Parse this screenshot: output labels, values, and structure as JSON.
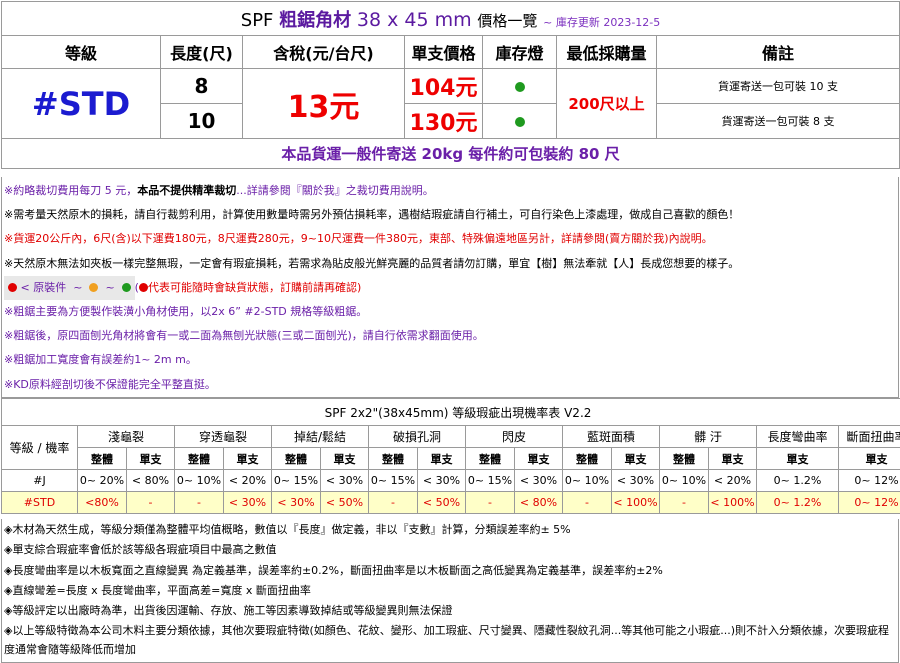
{
  "header": {
    "brand": "SPF",
    "material": "粗鋸角材",
    "size": "38 x 45 mm",
    "list": "價格一覽",
    "update": "~ 庫存更新 2023-12-5"
  },
  "columns": {
    "grade": "等級",
    "length": "長度(尺)",
    "tax": "含稅(元/台尺)",
    "unit_price": "單支價格",
    "stock": "庫存燈",
    "min_buy": "最低採購量",
    "remarks": "備註"
  },
  "product": {
    "grade": "#STD",
    "price": "13元",
    "min_buy": "200尺以上",
    "rows": [
      {
        "length": "8",
        "unit_price": "104元",
        "stock": "green-dot-icon",
        "remark": "貨運寄送一包可裝 10 支"
      },
      {
        "length": "10",
        "unit_price": "130元",
        "stock": "green-dot-icon",
        "remark": "貨運寄送一包可裝 8 支"
      }
    ]
  },
  "banner": "本品貨運一般件寄送 20kg 每件約可包裝約 80 尺",
  "notes": {
    "n1a": "※約略裁切費用每刀 5 元，",
    "n1b": "本品不提供精準裁切",
    "n1c": "...詳請參閱『關於我』之裁切費用說明。",
    "n2": "※需考量天然原木的損耗，請自行裁剪利用，計算使用數量時需另外預估損耗率，遇樹結瑕疵請自行補土，可自行染色上漆處理，做成自己喜歡的顏色！",
    "n3": "※貨運20公斤內，6尺(含)以下運費180元，8尺運費280元，9~10尺運費一件380元，東部、特殊偏遠地區另計，詳請參閱(賣方關於我)內說明。",
    "n4": "※天然原木無法如夾板一樣完整無瑕，一定會有瑕疵損耗，若需求為貼皮般光鮮亮麗的品質者請勿訂購，單宜【樹】無法牽就【人】長成您想要的樣子。",
    "n5_label": "< 原裝件",
    "n5_tilde": "~",
    "n5_paren": "(",
    "n5_text": "代表可能隨時會缺貨狀態，訂購前請再確認)",
    "n6": "※粗鋸主要為方便製作裝潢小角材使用，以2x 6”  #2-STD 規格等級粗鋸。",
    "n7": "※粗鋸後，原四面刨光角材將會有一或二面為無刨光狀態(三或二面刨光)，請自行依需求翻面使用。",
    "n8": "※粗鋸加工寬度會有誤差約1~ 2m m。",
    "n9": "※KD原料經剖切後不保證能完全平整直挺。"
  },
  "legend_colors": {
    "red": "#e00000",
    "orange": "#f0a020",
    "green": "#1f9a1f"
  },
  "defects": {
    "caption": "SPF 2x2\"(38x45mm) 等級瑕疵出現機率表 V2.2",
    "grade_header": "等級 / 機率",
    "categories": [
      "淺龜裂",
      "穿透龜裂",
      "掉結/鬆結",
      "破損孔洞",
      "閃皮",
      "藍斑面積",
      "髒 汙",
      "長度彎曲率",
      "斷面扭曲率"
    ],
    "sub_whole": "整體",
    "sub_single": "單支",
    "rows": [
      {
        "grade": "#J",
        "cells": [
          "0~ 20%",
          "< 80%",
          "0~ 10%",
          "< 20%",
          "0~ 15%",
          "< 30%",
          "0~ 15%",
          "< 30%",
          "0~ 15%",
          "< 30%",
          "0~ 10%",
          "< 30%",
          "0~ 10%",
          "< 20%",
          "0~ 1.2%",
          "0~ 12%"
        ]
      },
      {
        "grade": "#STD",
        "cells": [
          "<80%",
          "-",
          "-",
          "< 30%",
          "< 30%",
          "< 50%",
          "-",
          "< 50%",
          "-",
          "< 80%",
          "-",
          "< 100%",
          "-",
          "< 100%",
          "0~ 1.2%",
          "0~ 12%"
        ]
      }
    ]
  },
  "footnotes": [
    "◈木材為天然生成，等級分類僅為整體平均值概略，數值以『長度』做定義，非以『支數』計算，分類誤差率約± 5%",
    "◈單支綜合瑕疵率會低於該等級各瑕疵項目中最高之數值",
    "◈長度彎曲率是以木板寬面之直線變異 為定義基準，誤差率約±0.2%，斷面扭曲率是以木板斷面之高低變異為定義基準，誤差率約±2%",
    "◈直線彎差=長度 x 長度彎曲率，平面高差=寬度 x 斷面扭曲率",
    "◈等級評定以出廠時為準，出貨後因運輸、存放、施工等因素導致掉結或等級變異則無法保證",
    "◈以上等級特徵為本公司木料主要分類依據，其他次要瑕疵特徵(如顏色、花紋、變形、加工瑕疵、尺寸變異、隱藏性裂紋孔洞...等其他可能之小瑕疵...)則不計入分類依據，次要瑕疵程度通常會隨等級降低而增加"
  ]
}
